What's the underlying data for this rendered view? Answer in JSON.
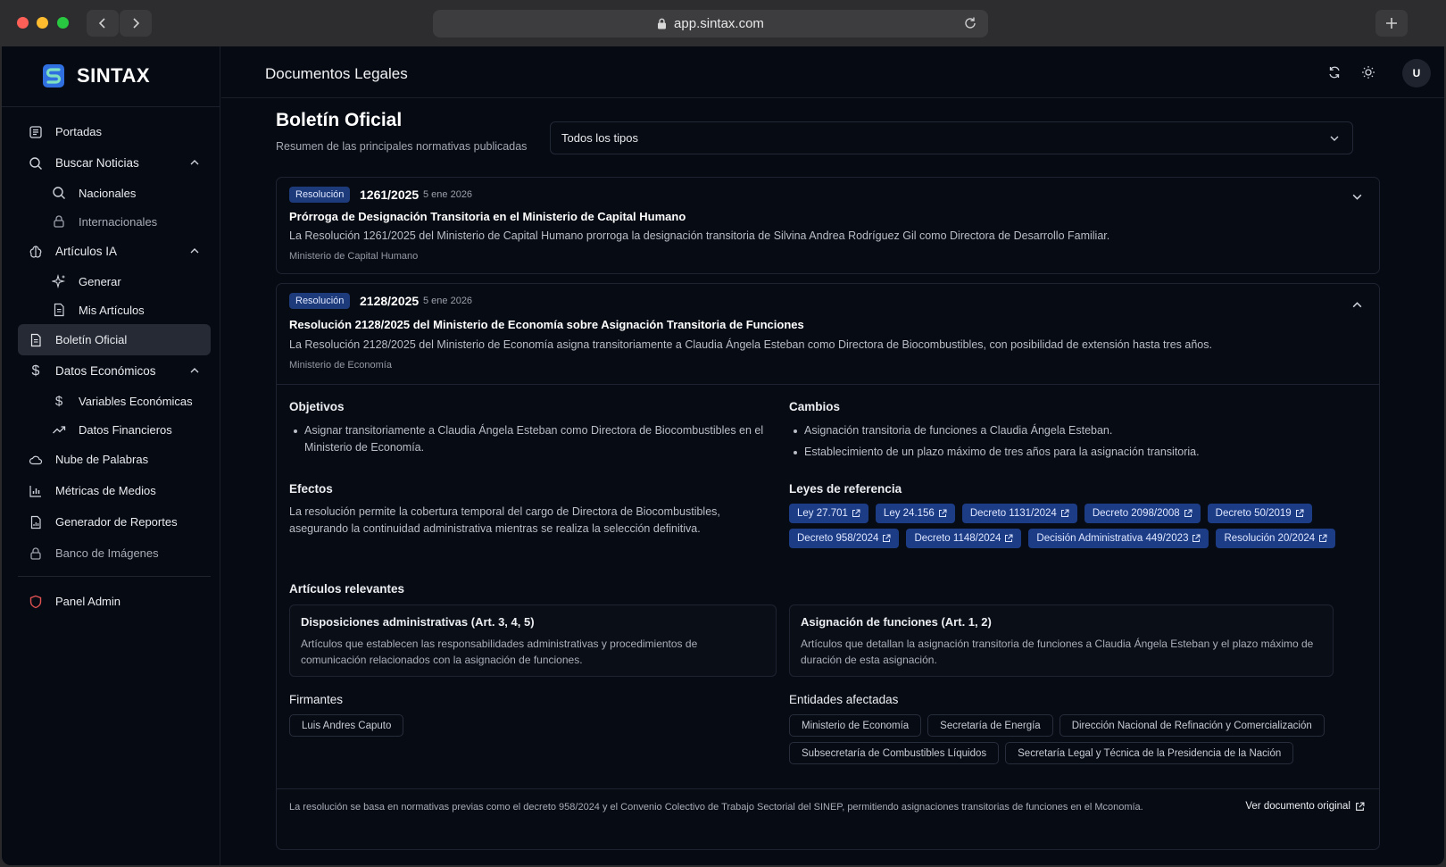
{
  "browser": {
    "url": "app.sintax.com"
  },
  "sidebar": {
    "brand": "SINTAX",
    "items": [
      {
        "label": "Portadas"
      },
      {
        "label": "Buscar Noticias"
      },
      {
        "label": "Nacionales"
      },
      {
        "label": "Internacionales"
      },
      {
        "label": "Artículos IA"
      },
      {
        "label": "Generar"
      },
      {
        "label": "Mis Artículos"
      },
      {
        "label": "Boletín Oficial"
      },
      {
        "label": "Datos Económicos"
      },
      {
        "label": "Variables Económicas"
      },
      {
        "label": "Datos Financieros"
      },
      {
        "label": "Nube de Palabras"
      },
      {
        "label": "Métricas de Medios"
      },
      {
        "label": "Generador de Reportes"
      },
      {
        "label": "Banco de Imágenes"
      },
      {
        "label": "Panel Admin"
      }
    ]
  },
  "header": {
    "title": "Documentos Legales",
    "avatar": "U"
  },
  "main": {
    "title": "Boletín Oficial",
    "subtitle": "Resumen de las principales normativas publicadas",
    "filter": "Todos los tipos"
  },
  "documents": [
    {
      "type": "Resolución",
      "number": "1261/2025",
      "date": "5 ene 2026",
      "title": "Prórroga de Designación Transitoria en el Ministerio de Capital Humano",
      "summary": "La Resolución 1261/2025 del Ministerio de Capital Humano prorroga la designación transitoria de Silvina Andrea Rodríguez Gil como Directora de Desarrollo Familiar.",
      "organism": "Ministerio de Capital Humano"
    },
    {
      "type": "Resolución",
      "number": "2128/2025",
      "date": "5 ene 2026",
      "title": "Resolución 2128/2025 del Ministerio de Economía sobre Asignación Transitoria de Funciones",
      "summary": "La Resolución 2128/2025 del Ministerio de Economía asigna transitoriamente a Claudia Ángela Esteban como Directora de Biocombustibles, con posibilidad de extensión hasta tres años.",
      "organism": "Ministerio de Economía",
      "details": {
        "objetivos_title": "Objetivos",
        "objetivos": [
          "Asignar transitoriamente a Claudia Ángela Esteban como Directora de Biocombustibles en el Ministerio de Economía."
        ],
        "cambios_title": "Cambios",
        "cambios": [
          "Asignación transitoria de funciones a Claudia Ángela Esteban.",
          "Establecimiento de un plazo máximo de tres años para la asignación transitoria."
        ],
        "efectos_title": "Efectos",
        "efectos": "La resolución permite la cobertura temporal del cargo de Directora de Biocombustibles, asegurando la continuidad administrativa mientras se realiza la selección definitiva.",
        "leyes_title": "Leyes de referencia",
        "leyes": [
          "Ley 27.701",
          "Ley 24.156",
          "Decreto 1131/2024",
          "Decreto 2098/2008",
          "Decreto 50/2019",
          "Decreto 958/2024",
          "Decreto 1148/2024",
          "Decisión Administrativa 449/2023",
          "Resolución 20/2024"
        ],
        "articulos_title": "Artículos relevantes",
        "articulos": [
          {
            "title": "Disposiciones administrativas (Art. 3, 4, 5)",
            "desc": "Artículos que establecen las responsabilidades administrativas y procedimientos de comunicación relacionados con la asignación de funciones."
          },
          {
            "title": "Asignación de funciones (Art. 1, 2)",
            "desc": "Artículos que detallan la asignación transitoria de funciones a Claudia Ángela Esteban y el plazo máximo de duración de esta asignación."
          }
        ],
        "firmantes_title": "Firmantes",
        "firmantes": [
          "Luis Andres Caputo"
        ],
        "entidades_title": "Entidades afectadas",
        "entidades": [
          "Ministerio de Economía",
          "Secretaría de Energía",
          "Dirección Nacional de Refinación y Comercialización",
          "Subsecretaría de Combustibles Líquidos",
          "Secretaría Legal y Técnica de la Presidencia de la Nación"
        ],
        "footer": "La resolución se basa en normativas previas como el decreto 958/2024 y el Convenio Colectivo de Trabajo Sectorial del SINEP, permitiendo asignaciones transitorias de funciones en el Mconomía.",
        "original_link": "Ver documento original"
      }
    }
  ],
  "colors": {
    "background": "#060a13",
    "badge": "#1d3a7a",
    "law_chip": "#1c3c86",
    "admin_icon": "#e05252"
  }
}
